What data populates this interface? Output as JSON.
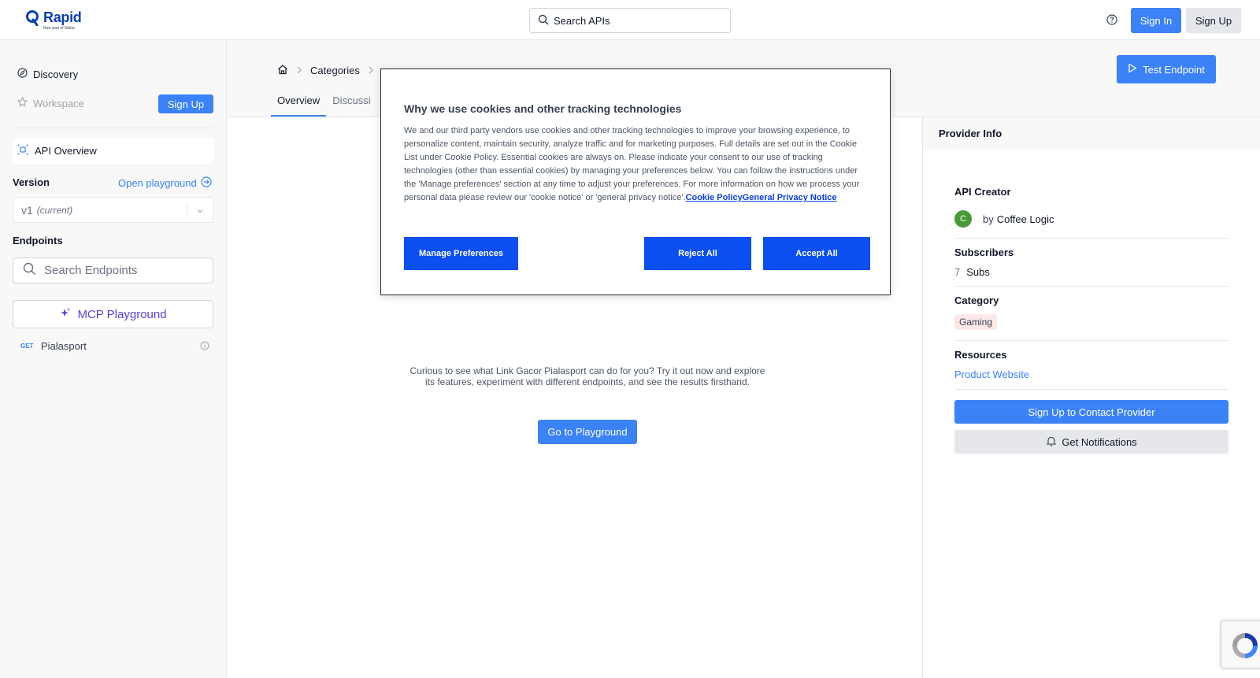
{
  "header": {
    "logo_name": "Rapid",
    "logo_sub": "Now part of Nokia",
    "search_placeholder": "Search APIs",
    "signin_label": "Sign In",
    "signup_label": "Sign Up"
  },
  "sidebar": {
    "discovery_label": "Discovery",
    "workspace_label": "Workspace",
    "signup_label": "Sign Up",
    "api_overview_label": "API Overview",
    "version_label": "Version",
    "open_playground_label": "Open playground",
    "version_value": "v1",
    "version_current": "(current)",
    "endpoints_label": "Endpoints",
    "endpoint_search_placeholder": "Search Endpoints",
    "mcp_label": "MCP Playground",
    "endpoints": [
      {
        "method": "GET",
        "name": "Pialasport"
      }
    ]
  },
  "main": {
    "breadcrumb": {
      "categories": "Categories"
    },
    "tabs": [
      {
        "label": "Overview",
        "active": true
      },
      {
        "label": "Discussi",
        "active": false
      }
    ],
    "test_endpoint_label": "Test Endpoint",
    "try_text": "Curious to see what Link Gacor Pialasport can do for you? Try it out now and explore its features, experiment with different endpoints, and see the results firsthand.",
    "go_playground_label": "Go to Playground"
  },
  "provider": {
    "title": "Provider Info",
    "api_creator_label": "API Creator",
    "creator_initial": "C",
    "creator_by": "by",
    "creator_name": "Coffee Logic",
    "subscribers_label": "Subscribers",
    "subscribers_count": "7",
    "subscribers_unit": "Subs",
    "category_label": "Category",
    "category_value": "Gaming",
    "resources_label": "Resources",
    "product_website_label": "Product Website",
    "contact_label": "Sign Up to Contact Provider",
    "notifications_label": "Get Notifications"
  },
  "cookie": {
    "title": "Why we use cookies and other tracking technologies",
    "body": "We and our third party vendors use cookies and other tracking technologies to improve your browsing experience, to personalize content, maintain security, analyze traffic and for marketing purposes. Full details are set out in the Cookie List under Cookie Policy. Essential cookies are always on. Please indicate your consent to our use of tracking technologies (other than essential cookies) by managing your preferences below. You can follow the instructions under the 'Manage preferences' section at any time to adjust your preferences. For more information on how we process your personal data please review our 'cookie notice' or 'general privacy notice'.",
    "cookie_policy_link": "Cookie Policy",
    "privacy_link": "General Privacy Notice",
    "manage_label": "Manage Preferences",
    "reject_label": "Reject All",
    "accept_label": "Accept All"
  },
  "colors": {
    "accent": "#3b82f6",
    "cookie_button": "#0b4ff0",
    "brand": "#0b3fb0",
    "mcp": "#5b3fd9",
    "gaming_badge_bg": "#fde8e8",
    "avatar": "#4a9a3a"
  }
}
